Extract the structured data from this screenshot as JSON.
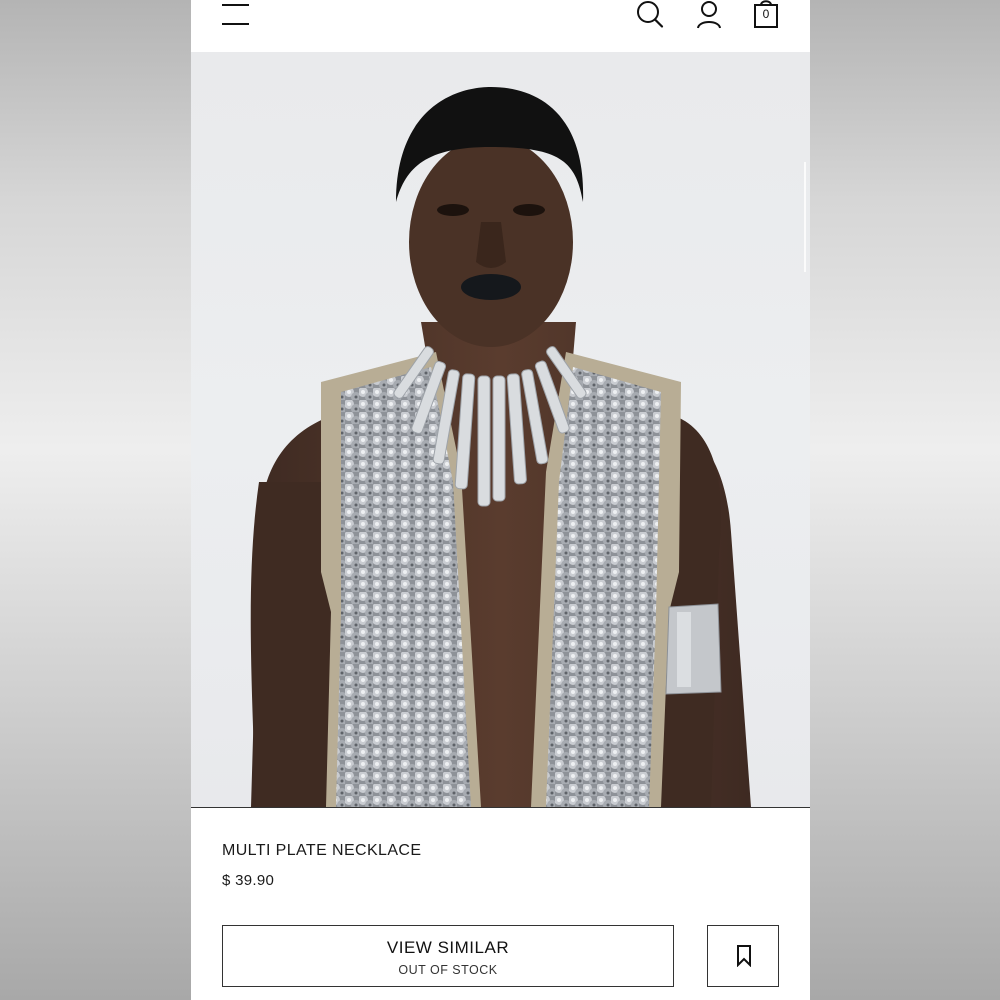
{
  "header": {
    "menu_icon": "hamburger-menu-icon",
    "search_icon": "search-icon",
    "account_icon": "user-icon",
    "cart_icon": "shopping-bag-icon",
    "cart_count": "0"
  },
  "product": {
    "name": "MULTI PLATE NECKLACE",
    "price": "$ 39.90",
    "image_icon": "product-photo"
  },
  "actions": {
    "view_similar_label": "VIEW SIMILAR",
    "stock_status": "OUT OF STOCK",
    "bookmark_icon": "bookmark-icon"
  },
  "colors": {
    "text": "#1a1a1a",
    "border": "#333333",
    "background": "#ffffff"
  }
}
